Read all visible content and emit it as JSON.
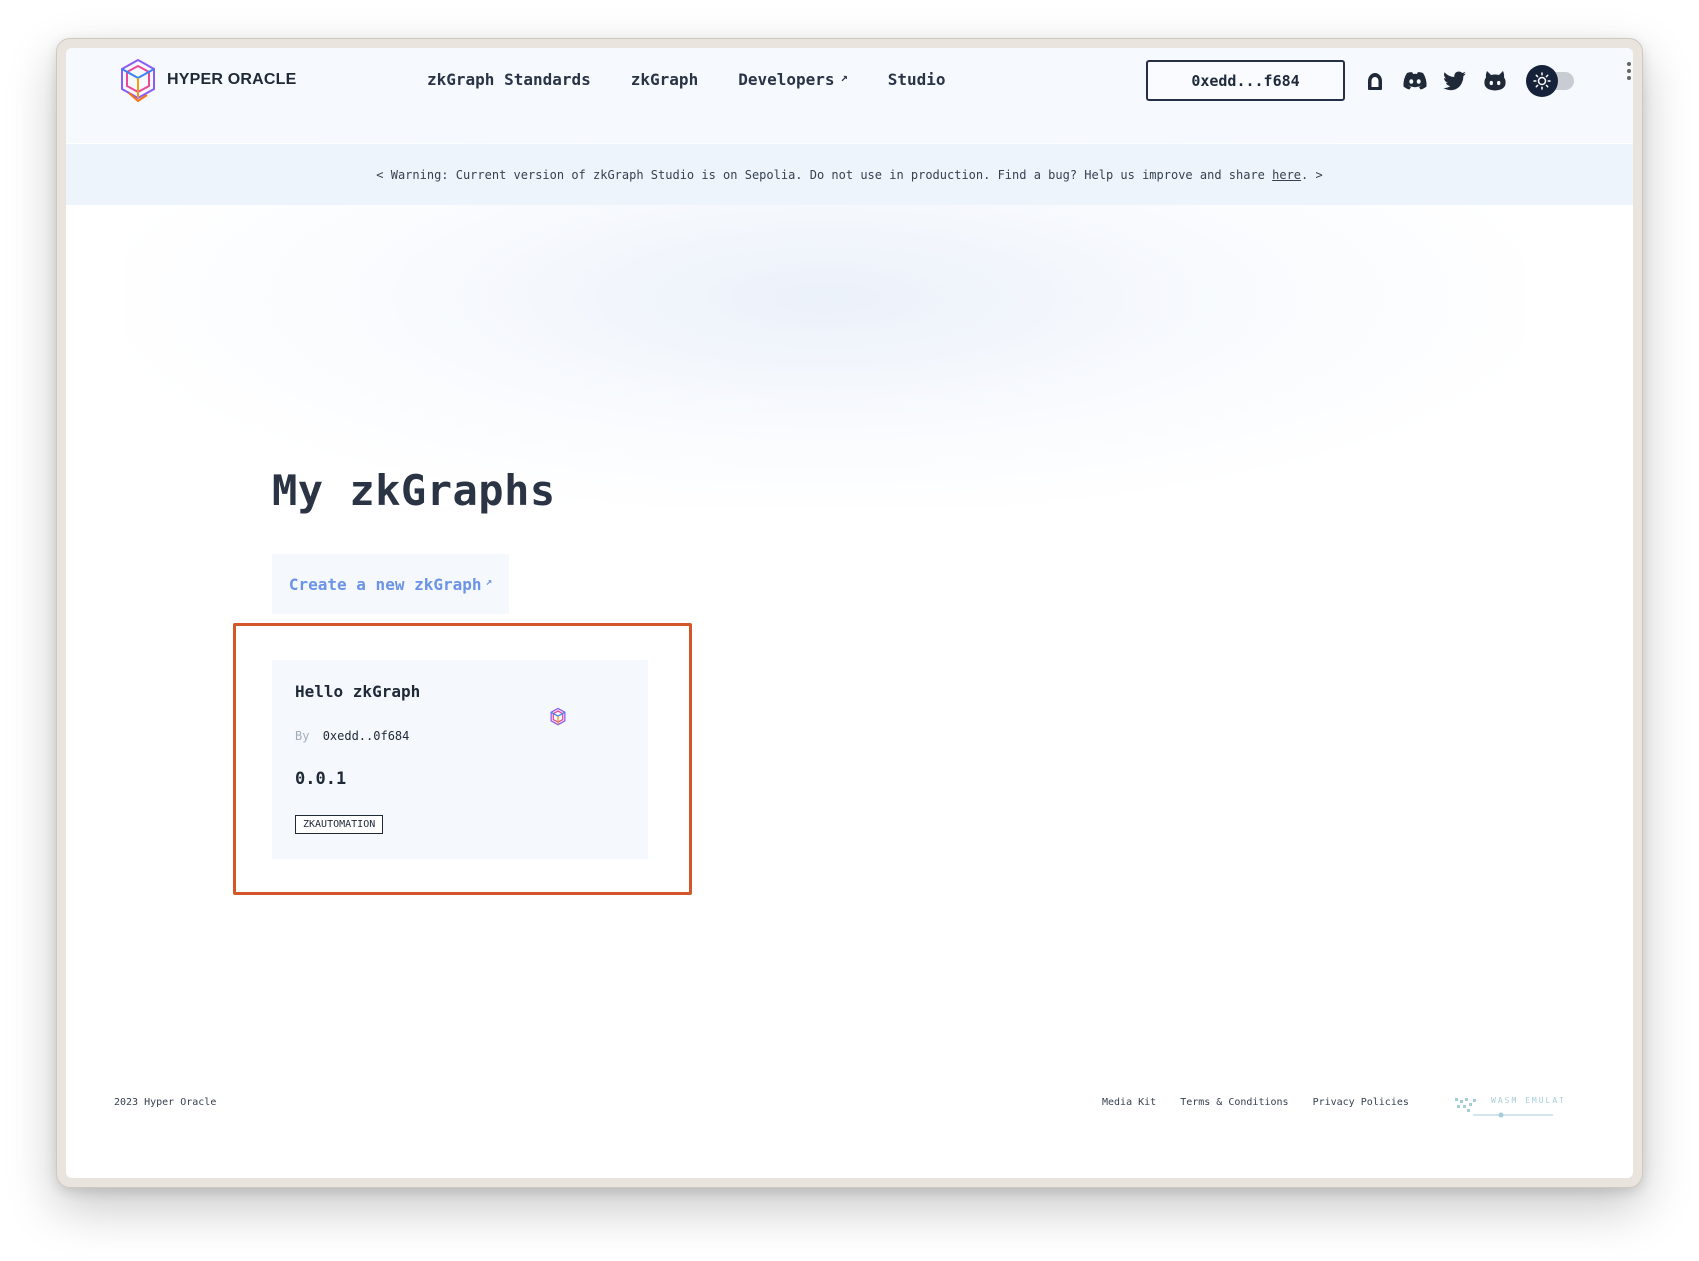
{
  "header": {
    "brand": "HYPER ORACLE",
    "nav": [
      {
        "label": "zkGraph Standards",
        "external": false
      },
      {
        "label": "zkGraph",
        "external": false
      },
      {
        "label": "Developers",
        "external": true
      },
      {
        "label": "Studio",
        "external": false
      }
    ],
    "wallet": "0xedd...f684",
    "social_icons": [
      "mirror-icon",
      "discord-icon",
      "twitter-icon",
      "github-icon"
    ],
    "theme_toggle_icon": "sun-icon",
    "external_arrow": "↗"
  },
  "banner": {
    "prefix": "< Warning: Current version of zkGraph Studio is on Sepolia. Do not use in production. Find a bug? Help us improve and share ",
    "link": "here",
    "suffix": ". >"
  },
  "main": {
    "title": "My zkGraphs",
    "create_label": "Create a new zkGraph",
    "cards": [
      {
        "title": "Hello zkGraph",
        "by_label": "By",
        "author": "0xedd..0f684",
        "version": "0.0.1",
        "tag": "ZKAUTOMATION"
      }
    ]
  },
  "footer": {
    "copyright": "2023 Hyper Oracle",
    "links": [
      "Media Kit",
      "Terms & Conditions",
      "Privacy Policies"
    ],
    "badge": "WASM EMULATOR"
  },
  "colors": {
    "accent": "#6b93e6",
    "highlight": "#d4572a",
    "text": "#1f2937",
    "dark": "#16213a"
  }
}
